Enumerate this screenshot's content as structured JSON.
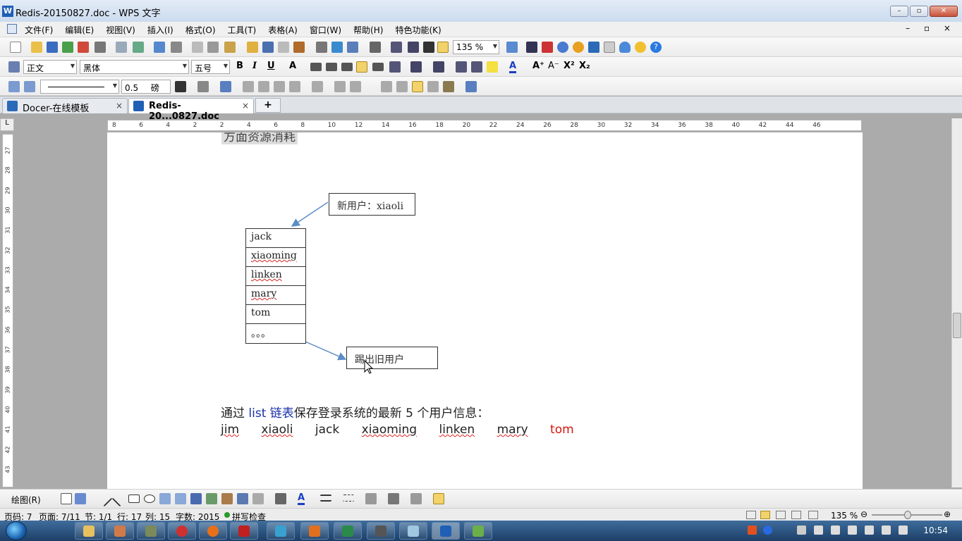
{
  "window": {
    "title": "Redis-20150827.doc - WPS 文字",
    "app_icon": "W"
  },
  "menu": {
    "items": [
      "文件(F)",
      "编辑(E)",
      "视图(V)",
      "插入(I)",
      "格式(O)",
      "工具(T)",
      "表格(A)",
      "窗口(W)",
      "帮助(H)",
      "特色功能(K)"
    ],
    "mdi_controls": "– ▫ ×"
  },
  "toolbar": {
    "zoom": "135 %",
    "style": "正文",
    "font": "黑体",
    "size": "五号",
    "line_width": "0.5",
    "line_unit": "磅"
  },
  "tabs": [
    {
      "label": "Docer-在线模板",
      "close": "×"
    },
    {
      "label": "Redis-20...0827.doc",
      "close": "×"
    }
  ],
  "tab_add": "+",
  "ruler": {
    "corner": "L",
    "h_ticks": [
      "8",
      "6",
      "4",
      "2",
      "2",
      "4",
      "6",
      "8",
      "10",
      "12",
      "14",
      "16",
      "18",
      "20",
      "22",
      "24",
      "26",
      "28",
      "30",
      "32",
      "34",
      "36",
      "38",
      "40",
      "42",
      "44",
      "46"
    ],
    "v_ticks": [
      "27",
      "28",
      "29",
      "30",
      "31",
      "32",
      "33",
      "34",
      "35",
      "36",
      "37",
      "38",
      "39",
      "40",
      "41",
      "42",
      "43"
    ]
  },
  "document": {
    "cut_off_text": "方面资源消耗",
    "new_user_label": "新用户：xiaoli",
    "list_items": [
      "jack",
      "xiaoming",
      "linken",
      "mary",
      "tom",
      "。。。"
    ],
    "evict_label": "踢出旧用户",
    "para1": {
      "prefix": "通过 ",
      "highlight": "list 链表",
      "suffix": "保存登录系统的最新 5 个用户信息："
    },
    "para2": [
      "jim",
      "xiaoli",
      "jack",
      "xiaoming",
      "linken",
      "mary",
      "tom"
    ]
  },
  "drawbar": {
    "label": "绘图(R)"
  },
  "status": {
    "page": "页码: 7",
    "pages": "页面: 7/11",
    "section": "节: 1/1",
    "row": "行: 17",
    "col": "列: 15",
    "words": "字数: 2015",
    "spell": "拼写检查",
    "zoom": "135 %"
  },
  "taskbar": {
    "clock": "10:54"
  },
  "colors": {
    "accent_blue": "#1a2fa8",
    "red": "#d6150c",
    "arrow": "#5b8ec7"
  }
}
